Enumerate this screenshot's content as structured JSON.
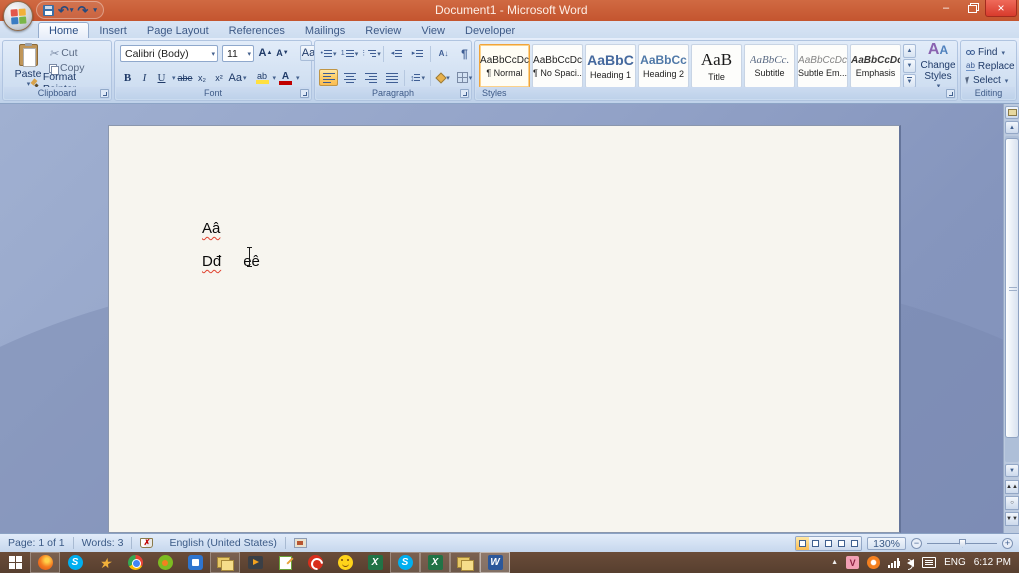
{
  "window": {
    "title": "Document1 - Microsoft Word",
    "controls": {
      "minimize": "–",
      "close": "×"
    }
  },
  "quick_access": {
    "undo_glyph": "↶",
    "redo_glyph": "↷",
    "dropdown_glyph": "▾"
  },
  "ribbon": {
    "tabs": [
      {
        "label": "Home"
      },
      {
        "label": "Insert"
      },
      {
        "label": "Page Layout"
      },
      {
        "label": "References"
      },
      {
        "label": "Mailings"
      },
      {
        "label": "Review"
      },
      {
        "label": "View"
      },
      {
        "label": "Developer"
      }
    ],
    "clipboard": {
      "label": "Clipboard",
      "paste": "Paste",
      "cut": "Cut",
      "copy": "Copy",
      "format_painter": "Format Painter"
    },
    "font": {
      "label": "Font",
      "name": "Calibri (Body)",
      "size": "11",
      "grow": "A",
      "shrink": "A",
      "clear": "Aa",
      "bold": "B",
      "italic": "I",
      "underline": "U",
      "strike": "abe",
      "subscript": "x₂",
      "superscript": "x²",
      "change_case": "Aa",
      "highlight": "ab",
      "color": "A",
      "highlight_color": "#ffe040",
      "font_color": "#c00000"
    },
    "paragraph": {
      "label": "Paragraph",
      "bullet": "•",
      "number": "1",
      "multi": "⋮",
      "indent_dec": "◂",
      "indent_inc": "▸",
      "sort": "A↓",
      "pilcrow": "¶",
      "spacing": "↕"
    },
    "styles": {
      "label": "Styles",
      "change_styles": "Change Styles",
      "scroll_up": "▲",
      "scroll_down": "▼",
      "more": "▼",
      "items": [
        {
          "preview": "AaBbCcDc",
          "name": "¶ Normal",
          "selected": true
        },
        {
          "preview": "AaBbCcDc",
          "name": "¶ No Spaci..."
        },
        {
          "preview": "AaBbC",
          "name": "Heading 1"
        },
        {
          "preview": "AaBbCc",
          "name": "Heading 2"
        },
        {
          "preview": "AaB",
          "name": "Title"
        },
        {
          "preview": "AaBbCc.",
          "name": "Subtitle"
        },
        {
          "preview": "AaBbCcDc",
          "name": "Subtle Em..."
        },
        {
          "preview": "AaBbCcDc",
          "name": "Emphasis"
        }
      ]
    },
    "editing": {
      "label": "Editing",
      "find": "Find",
      "replace": "Replace",
      "select": "Select",
      "replace_glyph": "ab"
    }
  },
  "document": {
    "word1": "Aâ",
    "word2": "Dđ",
    "word3": "eê"
  },
  "scrollbar": {
    "up": "▲",
    "down": "▼",
    "prev": "▲▲",
    "browse": "○",
    "next": "▼▼"
  },
  "status_bar": {
    "page": "Page: 1 of 1",
    "words": "Words: 3",
    "proof_glyph": "✗",
    "language": "English (United States)",
    "zoom_level": "130%",
    "zoom_out": "−",
    "zoom_in": "+"
  },
  "taskbar": {
    "skype_glyph": "S",
    "excel_glyph": "X",
    "word_glyph": "W",
    "tray_v": "V",
    "language": "ENG",
    "time": "6:12 PM"
  },
  "colors": {
    "titlebar": "#c85e3a",
    "close_button": "#e0493c",
    "accent_selected": "#fbbd52",
    "ribbon_bg": "#d4e2f3",
    "workspace": "#8d9dc3",
    "page": "#f7f5ef",
    "taskbar": "#5d4232",
    "squiggle": "#e0412e"
  }
}
